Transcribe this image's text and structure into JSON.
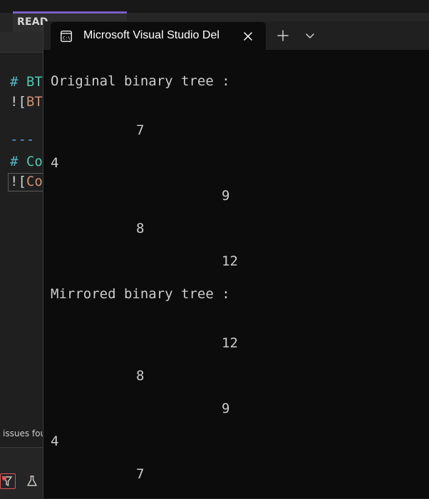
{
  "editor": {
    "tab_label": "READ",
    "lines": [
      {
        "hash": "#",
        "text": "BT"
      },
      {
        "bang": "![",
        "text": "BT"
      },
      {
        "rule": "---"
      },
      {
        "hash": "#",
        "text": "Co"
      },
      {
        "bang": "![",
        "text": "Co"
      }
    ],
    "issues_text": "issues fou"
  },
  "terminal": {
    "tab_title": "Microsoft Visual Studio Del",
    "icon": "console-app-icon",
    "output": {
      "original_heading": "Original binary tree :",
      "original_nodes": [
        "7",
        "4",
        "9",
        "8",
        "12"
      ],
      "mirrored_heading": "Mirrored binary tree :",
      "mirrored_nodes": [
        "12",
        "8",
        "9",
        "4",
        "7"
      ]
    }
  }
}
